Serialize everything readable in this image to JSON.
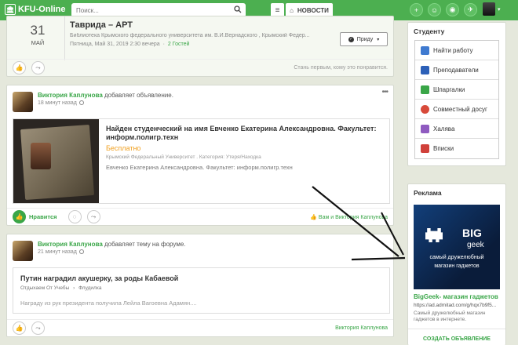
{
  "header": {
    "logo_icon": "🏛",
    "logo_text": "KFU-Online",
    "search_placeholder": "Поиск...",
    "news_label": "НОВОСТИ",
    "icons": [
      "plus-circle-icon",
      "users-icon",
      "eye-icon",
      "bird-icon"
    ]
  },
  "event": {
    "day": "31",
    "month": "МАЙ",
    "title": "Таврида – АРТ",
    "org": "Библиотека Крымского федерального университета им. В.И.Вернадского , Крымский Федер...",
    "date": "Пятница, Май 31, 2019 2:30 вечера",
    "guests": "2 Гостей",
    "attend_label": "Приду",
    "first_like": "Стань первым, кому это понравится."
  },
  "ad_post": {
    "author": "Виктория Каплунова",
    "action": " добавляет объявление.",
    "time": "18 минут назад",
    "title": "Найден студенческий на имя Евченко Екатерина Александровна. Факультет: информ.полигр.техн",
    "price": "Бесплатно",
    "category": "Крымский Федеральный Университет . Категория: Утеря/Находка",
    "desc": "Евченко Екатерина Александровна. Факультет: информ.полигр.техн",
    "like_label": "Нравится",
    "likes_text": "Вам и Виктория Каплунова"
  },
  "forum_post": {
    "author": "Виктория Каплунова",
    "action": " добавляет тему на форуме.",
    "time": "21 минут назад",
    "title": "Путин наградил акушерку, за роды Кабаевой",
    "crumb1": "Отдыхаем От Учебы",
    "crumb2": "Флудилка",
    "excerpt": "Награду из рук президента получила Лейла Вагоевна Адамян....",
    "footer_name": "Виктория Каплунова"
  },
  "sidebar": {
    "title": "Студенту",
    "items": [
      {
        "label": "Найти работу",
        "color": "#3f7ad0"
      },
      {
        "label": "Преподаватели",
        "color": "#2c60b8"
      },
      {
        "label": "Шпаргалки",
        "color": "#3aa648"
      },
      {
        "label": "Совместный досуг",
        "color": "#d84a3a"
      },
      {
        "label": "Халява",
        "color": "#8f5bc0"
      },
      {
        "label": "Вписки",
        "color": "#d0403a"
      }
    ]
  },
  "ad_block": {
    "title": "Реклама",
    "banner_big": "BIG",
    "banner_geek": "geek",
    "banner_line1": "самый дружелюбный",
    "banner_line2": "магазин гаджетов",
    "name": "BigGeek- магазин гаджетов",
    "url": "https://ad.admitad.com/g/hqx7b9f5...",
    "desc": "Самый дружелюбный магазин гаджетов в интернете.",
    "create_label": "СОЗДАТЬ ОБЪЯВЛЕНИЕ"
  },
  "colors": {
    "brand": "#4caf50",
    "link": "#3aa648",
    "price": "#f0a020"
  }
}
